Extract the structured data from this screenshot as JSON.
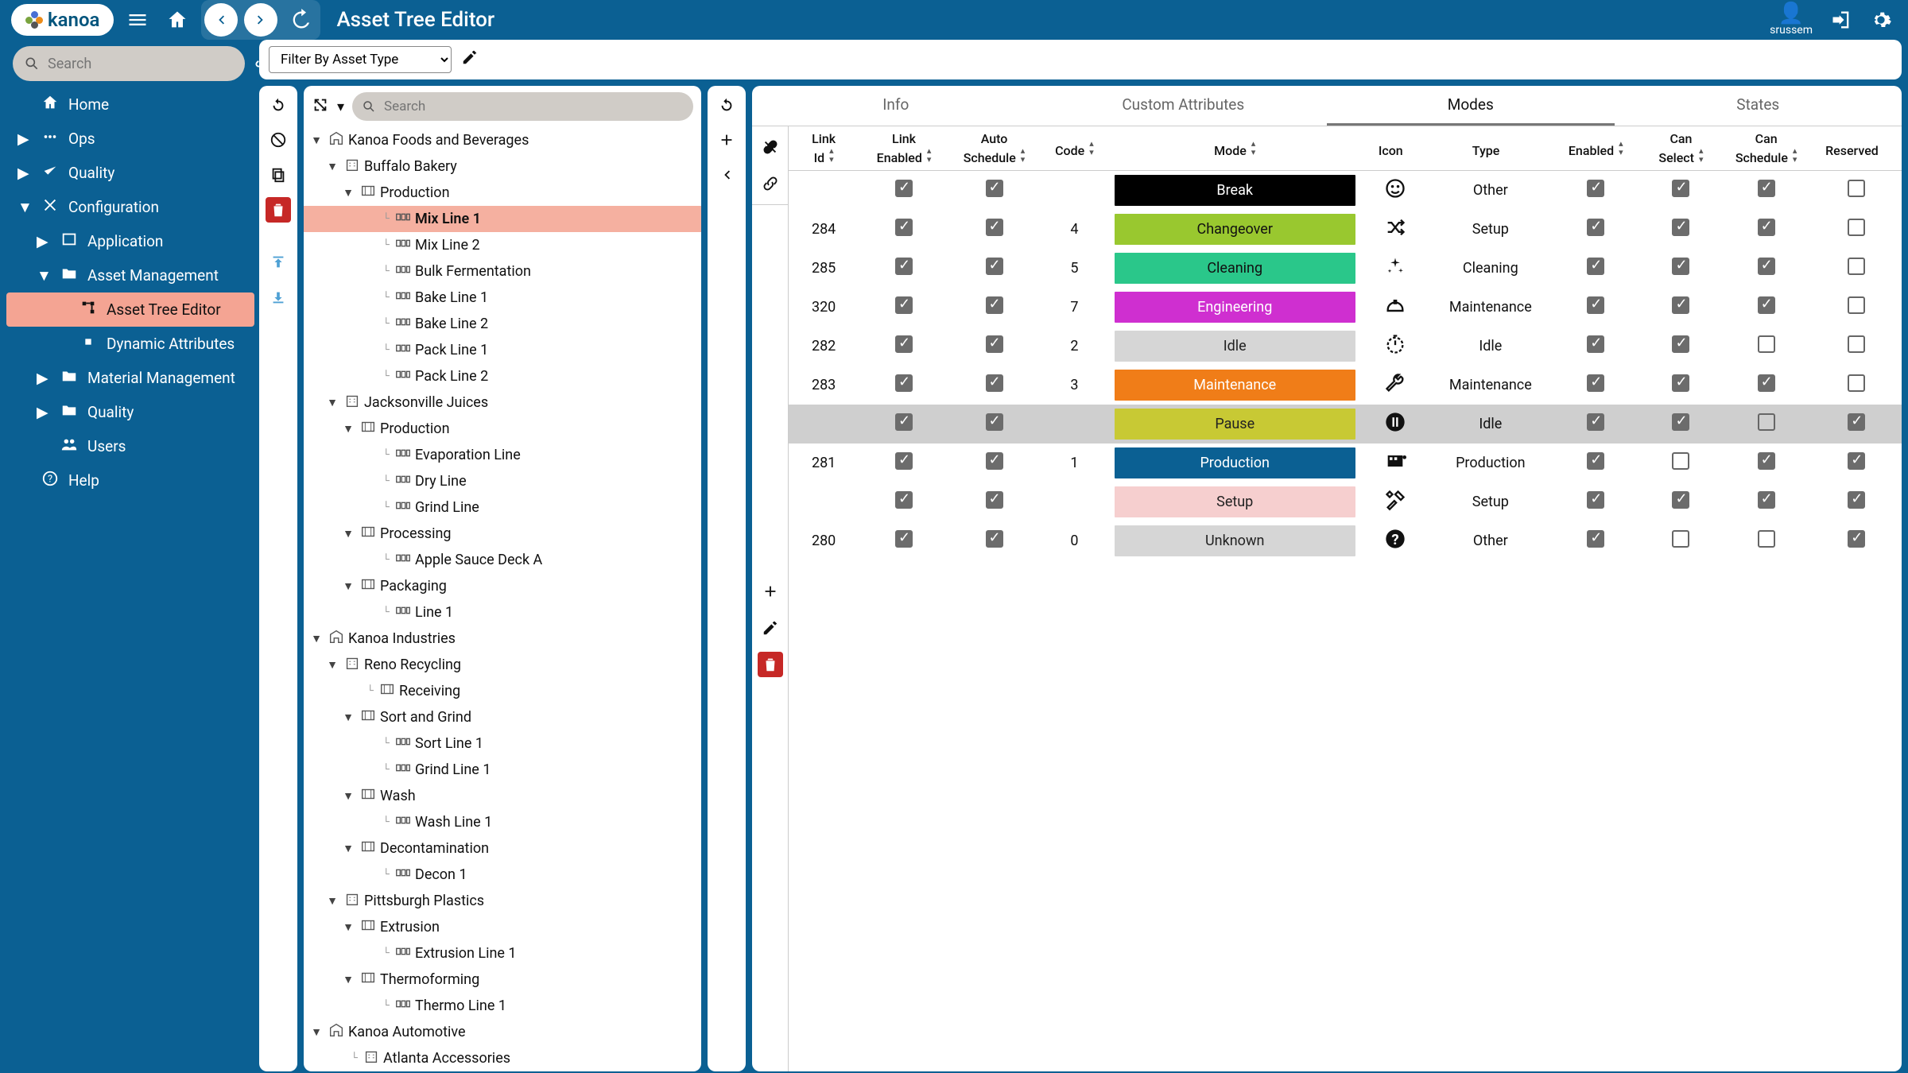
{
  "header": {
    "brand": "kanoa",
    "page_title": "Asset Tree Editor",
    "user": "srussem"
  },
  "sidebar": {
    "search_placeholder": "Search",
    "items": [
      {
        "label": "Home",
        "icon": "home",
        "caret": ""
      },
      {
        "label": "Ops",
        "icon": "ops",
        "caret": "▶",
        "indent": 0
      },
      {
        "label": "Quality",
        "icon": "quality",
        "caret": "▶",
        "indent": 0
      },
      {
        "label": "Configuration",
        "icon": "gear",
        "caret": "▼",
        "indent": 0
      },
      {
        "label": "Application",
        "icon": "window",
        "caret": "▶",
        "indent": 1
      },
      {
        "label": "Asset Management",
        "icon": "folder",
        "caret": "▼",
        "indent": 1
      },
      {
        "label": "Asset Tree Editor",
        "icon": "tree",
        "caret": "",
        "indent": 2,
        "selected": true
      },
      {
        "label": "Dynamic Attributes",
        "icon": "square",
        "caret": "",
        "indent": 2
      },
      {
        "label": "Material Management",
        "icon": "folder",
        "caret": "▶",
        "indent": 1
      },
      {
        "label": "Quality",
        "icon": "folder",
        "caret": "▶",
        "indent": 1
      },
      {
        "label": "Users",
        "icon": "users",
        "caret": "",
        "indent": 1
      },
      {
        "label": "Help",
        "icon": "help",
        "caret": "",
        "indent": 0
      }
    ]
  },
  "filter": {
    "placeholder": "Filter By Asset Type"
  },
  "tree": {
    "search_placeholder": "Search",
    "nodes": [
      {
        "l": 0,
        "c": "▼",
        "i": "enterprise",
        "t": "Kanoa Foods and Beverages"
      },
      {
        "l": 1,
        "c": "▼",
        "i": "site",
        "t": "Buffalo Bakery"
      },
      {
        "l": 2,
        "c": "▼",
        "i": "area",
        "t": "Production"
      },
      {
        "l": 3,
        "c": "",
        "i": "line",
        "t": "Mix Line 1",
        "sel": true,
        "el": true
      },
      {
        "l": 3,
        "c": "",
        "i": "line",
        "t": "Mix Line 2",
        "el": true
      },
      {
        "l": 3,
        "c": "",
        "i": "line",
        "t": "Bulk Fermentation",
        "el": true
      },
      {
        "l": 3,
        "c": "",
        "i": "line",
        "t": "Bake Line 1",
        "el": true
      },
      {
        "l": 3,
        "c": "",
        "i": "line",
        "t": "Bake Line 2",
        "el": true
      },
      {
        "l": 3,
        "c": "",
        "i": "line",
        "t": "Pack Line 1",
        "el": true
      },
      {
        "l": 3,
        "c": "",
        "i": "line",
        "t": "Pack Line 2",
        "el": true
      },
      {
        "l": 1,
        "c": "▼",
        "i": "site",
        "t": "Jacksonville Juices"
      },
      {
        "l": 2,
        "c": "▼",
        "i": "area",
        "t": "Production"
      },
      {
        "l": 3,
        "c": "",
        "i": "line",
        "t": "Evaporation Line",
        "el": true
      },
      {
        "l": 3,
        "c": "",
        "i": "line",
        "t": "Dry Line",
        "el": true
      },
      {
        "l": 3,
        "c": "",
        "i": "line",
        "t": "Grind Line",
        "el": true
      },
      {
        "l": 2,
        "c": "▼",
        "i": "area",
        "t": "Processing"
      },
      {
        "l": 3,
        "c": "",
        "i": "line",
        "t": "Apple Sauce Deck A",
        "el": true
      },
      {
        "l": 2,
        "c": "▼",
        "i": "area",
        "t": "Packaging"
      },
      {
        "l": 3,
        "c": "",
        "i": "line",
        "t": "Line 1",
        "el": true
      },
      {
        "l": 0,
        "c": "▼",
        "i": "enterprise",
        "t": "Kanoa Industries"
      },
      {
        "l": 1,
        "c": "▼",
        "i": "site",
        "t": "Reno Recycling"
      },
      {
        "l": 2,
        "c": "",
        "i": "area",
        "t": "Receiving",
        "el": true
      },
      {
        "l": 2,
        "c": "▼",
        "i": "area",
        "t": "Sort and Grind"
      },
      {
        "l": 3,
        "c": "",
        "i": "line",
        "t": "Sort Line 1",
        "el": true
      },
      {
        "l": 3,
        "c": "",
        "i": "line",
        "t": "Grind Line 1",
        "el": true
      },
      {
        "l": 2,
        "c": "▼",
        "i": "area",
        "t": "Wash"
      },
      {
        "l": 3,
        "c": "",
        "i": "line",
        "t": "Wash Line 1",
        "el": true
      },
      {
        "l": 2,
        "c": "▼",
        "i": "area",
        "t": "Decontamination"
      },
      {
        "l": 3,
        "c": "",
        "i": "line",
        "t": "Decon 1",
        "el": true
      },
      {
        "l": 1,
        "c": "▼",
        "i": "site",
        "t": "Pittsburgh Plastics"
      },
      {
        "l": 2,
        "c": "▼",
        "i": "area",
        "t": "Extrusion"
      },
      {
        "l": 3,
        "c": "",
        "i": "line",
        "t": "Extrusion Line 1",
        "el": true
      },
      {
        "l": 2,
        "c": "▼",
        "i": "area",
        "t": "Thermoforming"
      },
      {
        "l": 3,
        "c": "",
        "i": "line",
        "t": "Thermo Line 1",
        "el": true
      },
      {
        "l": 0,
        "c": "▼",
        "i": "enterprise",
        "t": "Kanoa Automotive"
      },
      {
        "l": 1,
        "c": "",
        "i": "site",
        "t": "Atlanta Accessories",
        "el": true
      }
    ]
  },
  "tabs": [
    "Info",
    "Custom Attributes",
    "Modes",
    "States"
  ],
  "active_tab": 2,
  "grid": {
    "columns": [
      "Link Id",
      "Link Enabled",
      "Auto Schedule",
      "Code",
      "Mode",
      "Icon",
      "Type",
      "Enabled",
      "Can Select",
      "Can Schedule",
      "Reserved"
    ],
    "rows": [
      {
        "id": "",
        "le": true,
        "as": true,
        "code": "",
        "mode": "Break",
        "bg": "#000000",
        "fg": "#ffffff",
        "icon": "smile",
        "type": "Other",
        "en": true,
        "sel": true,
        "sch": true,
        "res": false
      },
      {
        "id": "284",
        "le": true,
        "as": true,
        "code": "4",
        "mode": "Changeover",
        "bg": "#99c82f",
        "fg": "#111111",
        "icon": "shuffle",
        "type": "Setup",
        "en": true,
        "sel": true,
        "sch": true,
        "res": false
      },
      {
        "id": "285",
        "le": true,
        "as": true,
        "code": "5",
        "mode": "Cleaning",
        "bg": "#2ac78a",
        "fg": "#111111",
        "icon": "sparkle",
        "type": "Cleaning",
        "en": true,
        "sel": true,
        "sch": true,
        "res": false
      },
      {
        "id": "320",
        "le": true,
        "as": true,
        "code": "7",
        "mode": "Engineering",
        "bg": "#cf2fd0",
        "fg": "#ffffff",
        "icon": "hardhat",
        "type": "Maintenance",
        "en": true,
        "sel": true,
        "sch": true,
        "res": false
      },
      {
        "id": "282",
        "le": true,
        "as": true,
        "code": "2",
        "mode": "Idle",
        "bg": "#d6d6d6",
        "fg": "#222222",
        "icon": "timer",
        "type": "Idle",
        "en": true,
        "sel": true,
        "sch": false,
        "res": false
      },
      {
        "id": "283",
        "le": true,
        "as": true,
        "code": "3",
        "mode": "Maintenance",
        "bg": "#f07d18",
        "fg": "#ffffff",
        "icon": "wrench",
        "type": "Maintenance",
        "en": true,
        "sel": true,
        "sch": true,
        "res": false
      },
      {
        "id": "",
        "le": true,
        "as": true,
        "code": "",
        "mode": "Pause",
        "bg": "#c8c934",
        "fg": "#222222",
        "icon": "pause",
        "type": "Idle",
        "en": true,
        "sel": true,
        "sch": false,
        "res": true,
        "rowsel": true
      },
      {
        "id": "281",
        "le": true,
        "as": true,
        "code": "1",
        "mode": "Production",
        "bg": "#0b6093",
        "fg": "#ffffff",
        "icon": "film",
        "type": "Production",
        "en": true,
        "sel": false,
        "sch": true,
        "res": true
      },
      {
        "id": "",
        "le": true,
        "as": true,
        "code": "",
        "mode": "Setup",
        "bg": "#f6cfcf",
        "fg": "#222222",
        "icon": "tools",
        "type": "Setup",
        "en": true,
        "sel": true,
        "sch": true,
        "res": true
      },
      {
        "id": "280",
        "le": true,
        "as": true,
        "code": "0",
        "mode": "Unknown",
        "bg": "#d6d6d6",
        "fg": "#222222",
        "icon": "question",
        "type": "Other",
        "en": true,
        "sel": false,
        "sch": false,
        "res": true
      }
    ]
  }
}
